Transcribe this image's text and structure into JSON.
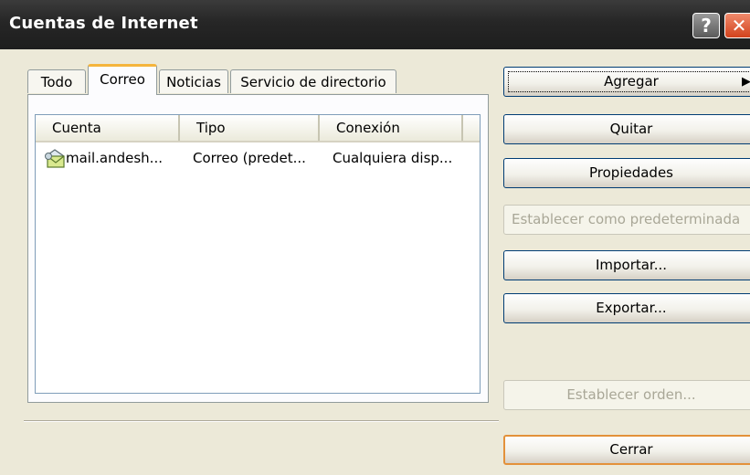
{
  "window": {
    "title": "Cuentas de Internet",
    "help_label": "?",
    "close_label": "✕"
  },
  "tabs": [
    {
      "label": "Todo",
      "active": false
    },
    {
      "label": "Correo",
      "active": true
    },
    {
      "label": "Noticias",
      "active": false
    },
    {
      "label": "Servicio de directorio",
      "active": false
    }
  ],
  "list": {
    "columns": [
      "Cuenta",
      "Tipo",
      "Conexión"
    ],
    "rows": [
      {
        "account": "mail.andesh...",
        "type": "Correo (predet...",
        "connection": "Cualquiera disp...",
        "icon": "mail-account-icon"
      }
    ]
  },
  "buttons": {
    "add": "Agregar",
    "add_arrow": "▶",
    "remove": "Quitar",
    "properties": "Propiedades",
    "set_default": "Establecer como predeterminada",
    "import": "Importar...",
    "export": "Exportar...",
    "set_order": "Establecer orden...",
    "close": "Cerrar"
  },
  "colors": {
    "titlebar": "#262626",
    "tab_highlight": "#f5b53c",
    "close_button": "#d2421c",
    "default_button_border": "#e3913a"
  }
}
